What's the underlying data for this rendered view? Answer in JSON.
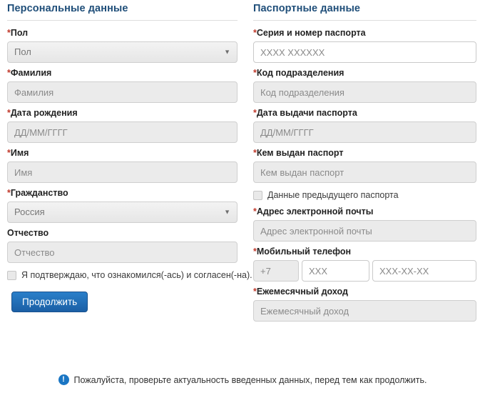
{
  "form": {
    "required_marker": "*",
    "left": {
      "title": "Персональные данные",
      "fields": [
        {
          "label": "Пол",
          "required": true,
          "type": "select",
          "value": "Пол",
          "caret": "▼"
        },
        {
          "label": "Фамилия",
          "required": true,
          "type": "text",
          "placeholder": "Фамилия",
          "style": "gray"
        },
        {
          "label": "Дата рождения",
          "required": true,
          "type": "text",
          "placeholder": "ДД/ММ/ГГГГ",
          "style": "gray"
        },
        {
          "label": "Имя",
          "required": true,
          "type": "text",
          "placeholder": "Имя",
          "style": "gray"
        },
        {
          "label": "Гражданство",
          "required": true,
          "type": "select",
          "value": "Россия",
          "caret": "▼"
        },
        {
          "label": "Отчество",
          "required": false,
          "type": "text",
          "placeholder": "Отчество",
          "style": "gray"
        }
      ],
      "consent_label": "Я подтверждаю, что ознакомился(-ась) и согласен(-на).",
      "consent_checked": false,
      "submit_label": "Продолжить"
    },
    "right": {
      "title": "Паспортные данные",
      "fields": [
        {
          "label": "Серия и номер паспорта",
          "required": true,
          "type": "text",
          "placeholder": "XXXX XXXXXX",
          "style": "white"
        },
        {
          "label": "Код подразделения",
          "required": true,
          "type": "text",
          "placeholder": "Код подразделения",
          "style": "gray"
        },
        {
          "label": "Дата выдачи паспорта",
          "required": true,
          "type": "text",
          "placeholder": "ДД/ММ/ГГГГ",
          "style": "gray"
        },
        {
          "label": "Кем выдан паспорт",
          "required": true,
          "type": "text",
          "placeholder": "Кем выдан паспорт",
          "style": "gray"
        }
      ],
      "prev_passport_label": "Данные предыдущего паспорта",
      "prev_passport_checked": false,
      "email": {
        "label": "Адрес электронной почты",
        "required": true,
        "placeholder": "Адрес электронной почты"
      },
      "phone": {
        "label": "Мобильный телефон",
        "required": true,
        "code": "+7",
        "area_placeholder": "XXX",
        "number_placeholder": "XXX-XX-XX"
      },
      "income": {
        "label": "Ежемесячный доход",
        "required": true,
        "placeholder": "Ежемесячный доход"
      }
    },
    "footer": {
      "icon": "info-exclamation-icon",
      "icon_glyph": "!",
      "text": "Пожалуйста, проверьте актуальность введенных данных, перед тем как продолжить."
    },
    "colors": {
      "heading": "#1f4e79",
      "required": "#c0392b",
      "button": "#1b5fa5",
      "info": "#1a76c4",
      "field_gray": "#ebebeb"
    }
  }
}
